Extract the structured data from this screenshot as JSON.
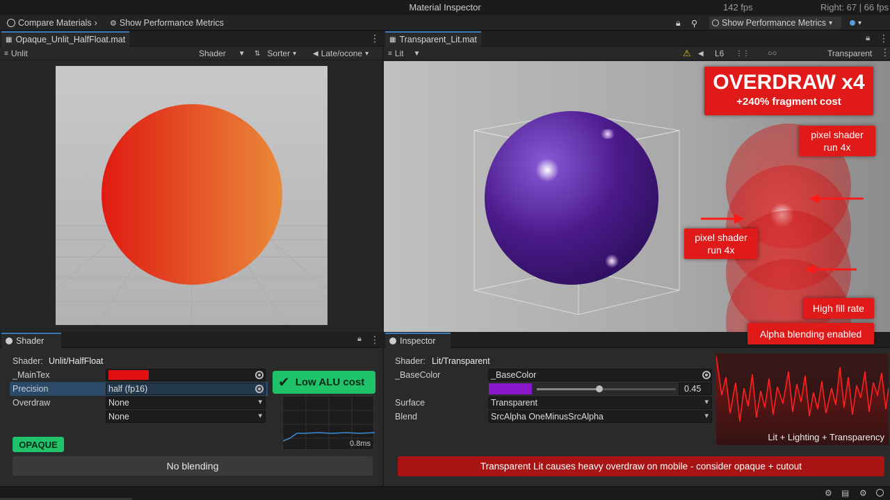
{
  "window": {
    "title": "Material Inspector",
    "fps_left": "142 fps",
    "fps_right": "Right: 67 | 66 fps"
  },
  "toolbar": {
    "compare_label": "Compare Materials",
    "perf_label": "Show Performance Metrics",
    "perf_dropdown_label": "Show Performance Metrics"
  },
  "left_view": {
    "tab": "Opaque_Unlit_HalfFloat.mat",
    "mode": "Unlit",
    "shader_menu": "Shader",
    "sorter_menu": "Sorter",
    "late_menu": "Late/ocone",
    "colors": {
      "sphere_start": "#e01a12",
      "sphere_end": "#ea8a3a",
      "backdrop": "#c9c9c9"
    }
  },
  "right_view": {
    "tab": "Transparent_Lit.mat",
    "mode": "Lit",
    "lod_label": "L6",
    "render_label": "Transparent",
    "overdraw_title": "OVERDRAW x4",
    "overdraw_sub": "+240% fragment cost",
    "callout_top": "pixel shader run 4x",
    "callout_mid": "pixel shader run 4x",
    "callout_fill": "High fill rate",
    "callout_alpha": "Alpha blending enabled",
    "colors": {
      "sphere": "#4a1a8a",
      "alert": "#e01919"
    }
  },
  "shader_panel": {
    "tab": "Shader",
    "shader_label": "Shader:",
    "shader_value": "Unlit/HalfFloat",
    "maintex_label": "_MainTex",
    "precision_label": "Precision",
    "precision_value": "half (fp16)",
    "overdraw_label": "Overdraw",
    "overdraw_value": "None",
    "extra_value": "None",
    "alu_badge": "Low ALU cost",
    "graph_value": "0.8ms",
    "opaque_badge": "OPAQUE",
    "blend_bar": "No blending",
    "colors": {
      "maintex": "#e01010",
      "green": "#1fc46a"
    }
  },
  "inspector_panel": {
    "tab": "Inspector",
    "shader_label": "Shader:",
    "shader_value": "Lit/Transparent",
    "basecolor_label": "_BaseColor",
    "basecolor_name": "_BaseColor",
    "alpha_value": "0.45",
    "alpha_fraction": 0.45,
    "surface_label": "Surface",
    "surface_value": "Transparent",
    "blend_label": "Blend",
    "blend_value": "SrcAlpha OneMinusSrcAlpha",
    "graph_caption": "Lit + Lighting + Transparency",
    "warning": "Transparent Lit causes heavy overdraw on mobile - consider opaque + cutout",
    "colors": {
      "basecolor": "#8a17c9",
      "graph": "#ff1a1a",
      "warning_bg": "#a81414"
    }
  }
}
